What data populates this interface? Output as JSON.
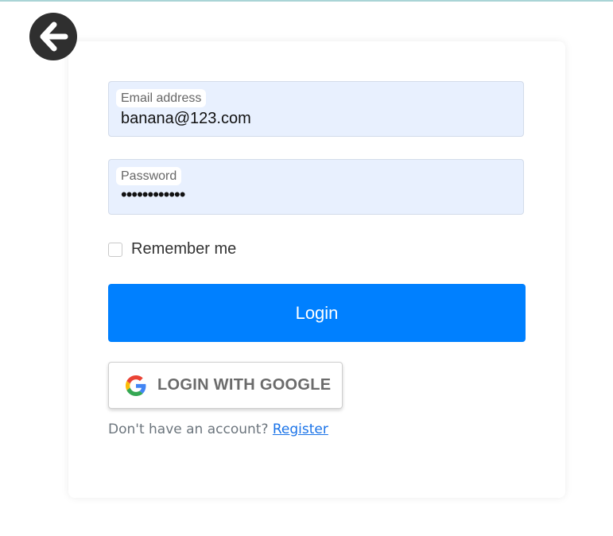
{
  "icons": {
    "back": "arrow-left-icon",
    "google": "google-g-icon"
  },
  "colors": {
    "primary_button": "#0080ff",
    "input_background": "#e8f0fe",
    "link": "#1a73e8",
    "back_button": "#2f2f2f"
  },
  "form": {
    "email": {
      "label": "Email address",
      "value": "banana@123.com"
    },
    "password": {
      "label": "Password",
      "value": "••••••••••••"
    },
    "remember": {
      "label": "Remember me",
      "checked": false
    },
    "login_label": "Login",
    "google_label": "LOGIN WITH GOOGLE",
    "register_prompt": "Don't have an account?",
    "register_link": "Register"
  }
}
